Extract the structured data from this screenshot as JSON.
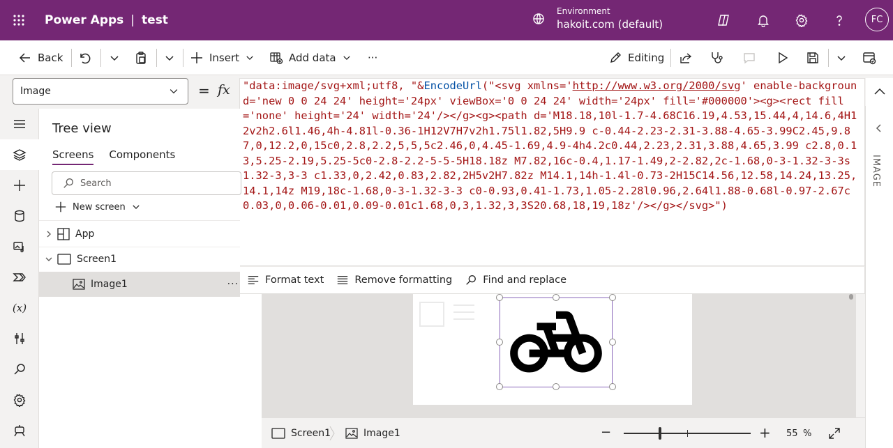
{
  "topbar": {
    "app_name": "Power Apps",
    "separator": "|",
    "app_title": "test",
    "environment_label": "Environment",
    "environment_value": "hakoit.com (default)",
    "avatar_initials": "FC",
    "icons": [
      "waffle-icon",
      "environment-icon",
      "copilot-icon",
      "notification-bell-icon",
      "settings-gear-icon",
      "help-icon"
    ]
  },
  "commandbar": {
    "back": "Back",
    "insert": "Insert",
    "add_data": "Add data",
    "more": "···",
    "editing": "Editing"
  },
  "formula": {
    "property": "Image",
    "equals": "=",
    "fx": "fx",
    "code_prefix": "\"data:image/svg+xml;utf8, \"&",
    "code_fn": "EncodeUrl",
    "code_mid": "(\"<svg xmlns='",
    "code_url": "http://www.w3.org/2000/svg",
    "code_rest": "' enable-background='new 0 0 24 24' height='24px' viewBox='0 0 24 24' width='24px' fill='#000000'><g><rect fill='none' height='24' width='24'/></g><g><path d='M18.18,10l-1.7-4.68C16.19,4.53,15.44,4,14.6,4H12v2h2.6l1.46,4h-4.81l-0.36-1H12V7H7v2h1.75l1.82,5H9.9 c-0.44-2.23-2.31-3.88-4.65-3.99C2.45,9.87,0,12.2,0,15c0,2.8,2.2,5,5,5c2.46,0,4.45-1.69,4.9-4h4.2c0.44,2.23,2.31,3.88,4.65,3.99 c2.8,0.13,5.25-2.19,5.25-5c0-2.8-2.2-5-5-5H18.18z M7.82,16c-0.4,1.17-1.49,2-2.82,2c-1.68,0-3-1.32-3-3s1.32-3,3-3 c1.33,0,2.42,0.83,2.82,2H5v2H7.82z M14.1,14h-1.4l-0.73-2H15C14.56,12.58,14.24,13.25,14.1,14z M19,18c-1.68,0-3-1.32-3-3 c0-0.93,0.41-1.73,1.05-2.28l0.96,2.64l1.88-0.68l-0.97-2.67c0.03,0,0.06-0.01,0.09-0.01c1.68,0,3,1.32,3,3S20.68,18,19,18z'/></g></svg>\")",
    "toolbar": {
      "format_text": "Format text",
      "remove_formatting": "Remove formatting",
      "find_replace": "Find and replace"
    }
  },
  "tree": {
    "title": "Tree view",
    "tab_screens": "Screens",
    "tab_components": "Components",
    "search_placeholder": "Search",
    "new_screen": "New screen",
    "items": [
      {
        "label": "App"
      },
      {
        "label": "Screen1"
      },
      {
        "label": "Image1"
      }
    ],
    "row_more": "···"
  },
  "right_panel": {
    "label": "IMAGE"
  },
  "statusbar": {
    "crumb_screen": "Screen1",
    "crumb_image": "Image1",
    "zoom_minus": "−",
    "zoom_plus": "+",
    "zoom_value": "55",
    "zoom_unit": "%",
    "zoom_level": 0.55
  },
  "colors": {
    "brand": "#742774",
    "selection": "#8764b8",
    "code_string": "#a31515",
    "code_function": "#0451a5"
  }
}
